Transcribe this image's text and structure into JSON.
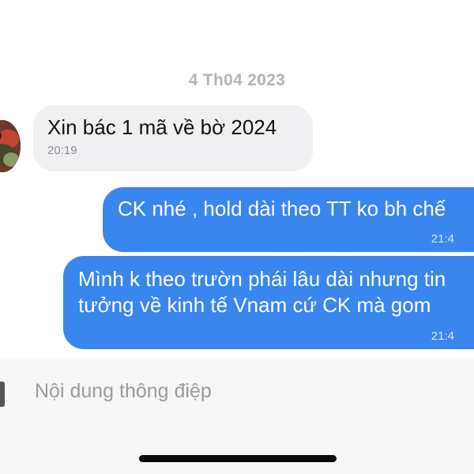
{
  "date_separator": "4 Th04 2023",
  "messages": [
    {
      "direction": "incoming",
      "lines": [
        "Xin bác 1 mã về bờ 2024"
      ],
      "time": "20:19"
    },
    {
      "direction": "outgoing",
      "lines": [
        "CK nhé , hold dài theo TT ko bh chế"
      ],
      "time": "21:4"
    },
    {
      "direction": "outgoing",
      "lines": [
        "Mình k theo trườn phái lâu dài nhưng tin",
        "tưởng về kinh tế Vnam cứ CK mà gom"
      ],
      "time": "21:4"
    }
  ],
  "composer": {
    "placeholder": "Nội dung thông điệp"
  },
  "colors": {
    "outgoing_bubble": "#3a86ef",
    "incoming_bubble": "#f0f0f2",
    "date_text": "#b3b3b8"
  }
}
